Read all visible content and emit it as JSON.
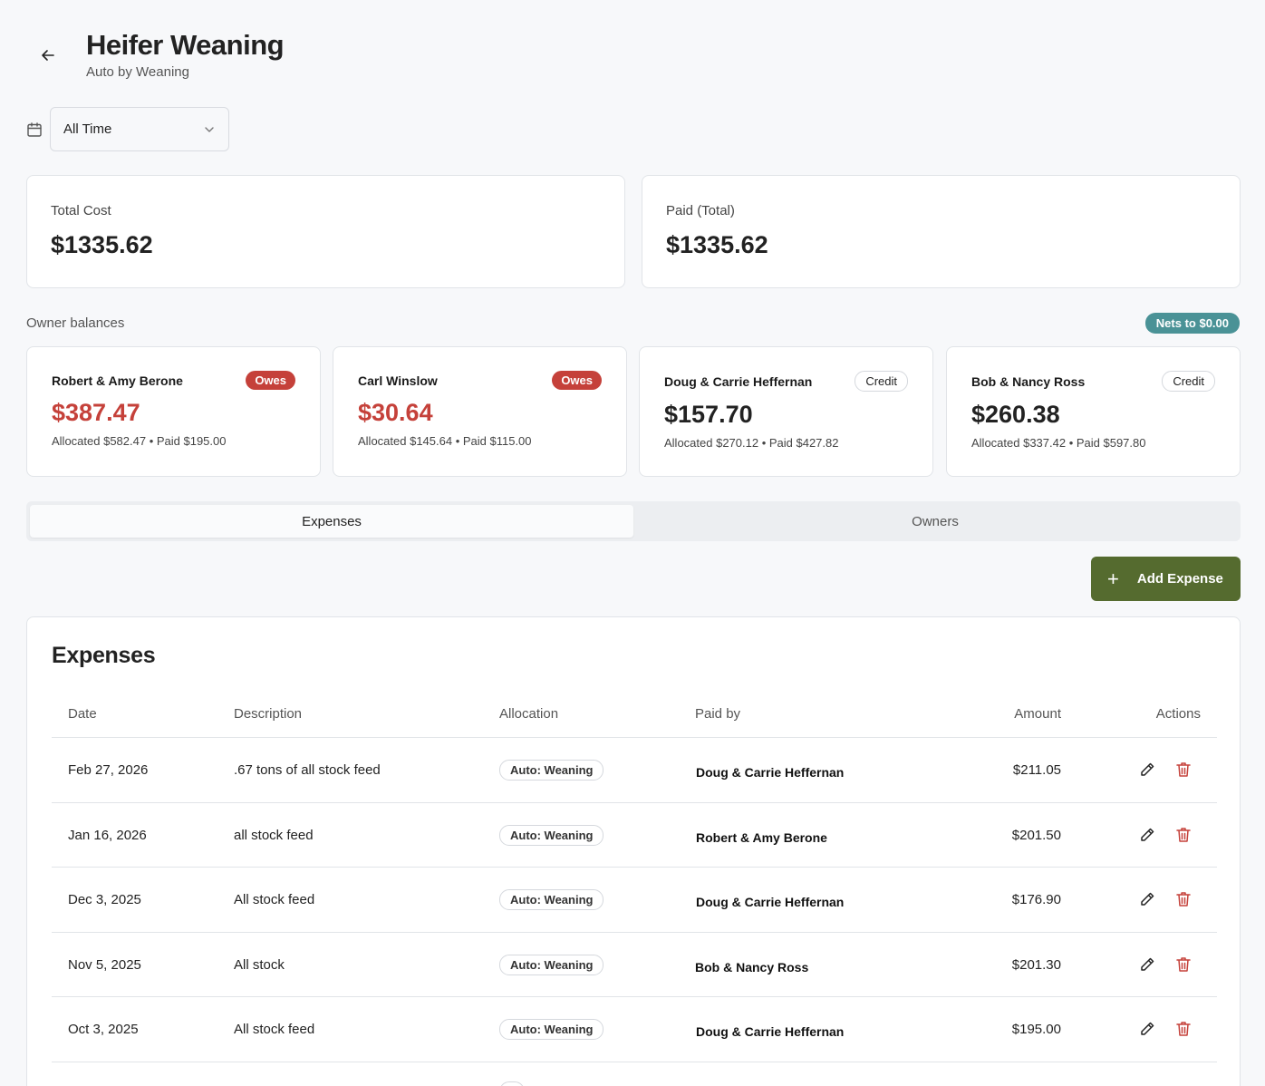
{
  "header": {
    "title": "Heifer Weaning",
    "subtitle": "Auto by Weaning"
  },
  "filter": {
    "selected": "All Time"
  },
  "stats": {
    "total_cost_label": "Total Cost",
    "total_cost_value": "$1335.62",
    "paid_label": "Paid (Total)",
    "paid_value": "$1335.62"
  },
  "balances": {
    "section_label": "Owner balances",
    "nets_badge": "Nets to $0.00",
    "owners": [
      {
        "name": "Robert & Amy Berone",
        "status": "Owes",
        "amount": "$387.47",
        "detail": "Allocated $582.47 • Paid $195.00"
      },
      {
        "name": "Carl Winslow",
        "status": "Owes",
        "amount": "$30.64",
        "detail": "Allocated $145.64 • Paid $115.00"
      },
      {
        "name": "Doug & Carrie Heffernan",
        "status": "Credit",
        "amount": "$157.70",
        "detail": "Allocated $270.12 • Paid $427.82"
      },
      {
        "name": "Bob & Nancy Ross",
        "status": "Credit",
        "amount": "$260.38",
        "detail": "Allocated $337.42 • Paid $597.80"
      }
    ]
  },
  "tabs": [
    {
      "label": "Expenses",
      "active": true
    },
    {
      "label": "Owners",
      "active": false
    }
  ],
  "add_button": {
    "label": "Add Expense"
  },
  "expenses": {
    "title": "Expenses",
    "columns": [
      "Date",
      "Description",
      "Allocation",
      "Paid by",
      "Amount",
      "Actions"
    ],
    "rows": [
      {
        "date": "Feb 27, 2026",
        "description": ".67 tons of all stock feed",
        "allocation": "Auto: Weaning",
        "paid_by": "Doug & Carrie Heffernan",
        "amount": "$211.05"
      },
      {
        "date": "Jan 16, 2026",
        "description": "all stock feed",
        "allocation": "Auto: Weaning",
        "paid_by": "Robert & Amy Berone",
        "amount": "$201.50"
      },
      {
        "date": "Dec 3, 2025",
        "description": "All stock feed",
        "allocation": "Auto: Weaning",
        "paid_by": "Doug & Carrie Heffernan",
        "amount": "$176.90"
      },
      {
        "date": "Nov 5, 2025",
        "description": "All stock",
        "allocation": "Auto: Weaning",
        "paid_by": "Bob & Nancy Ross",
        "amount": "$201.30"
      },
      {
        "date": "Oct 3, 2025",
        "description": "All stock feed",
        "allocation": "Auto: Weaning",
        "paid_by": "Doug & Carrie Heffernan",
        "amount": "$195.00"
      }
    ]
  },
  "colors": {
    "owes": "#c5413a",
    "accent_green": "#556b2f",
    "nets_teal": "#4a9296"
  }
}
